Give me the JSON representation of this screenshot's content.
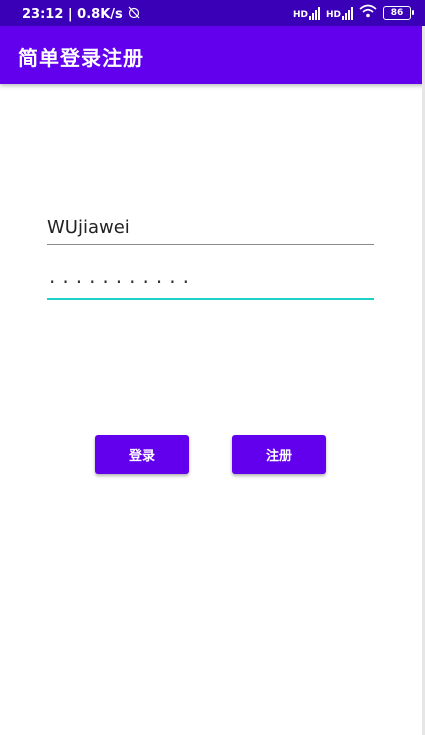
{
  "status_bar": {
    "time_speed": "23:12 | 0.8K/s",
    "sim1_tag": "HD",
    "sim2_tag": "HD",
    "battery_level": "86",
    "icons": [
      "alarm-off-icon",
      "signal-icon",
      "signal-icon",
      "wifi-icon",
      "battery-icon"
    ]
  },
  "app_bar": {
    "title": "简单登录注册"
  },
  "form": {
    "username_value": "WUjiawei",
    "password_masked": "···········"
  },
  "buttons": {
    "login_label": "登录",
    "register_label": "注册"
  },
  "colors": {
    "primary": "#6200ee",
    "status_bar": "#3a00b8",
    "accent": "#1dd1c8"
  }
}
